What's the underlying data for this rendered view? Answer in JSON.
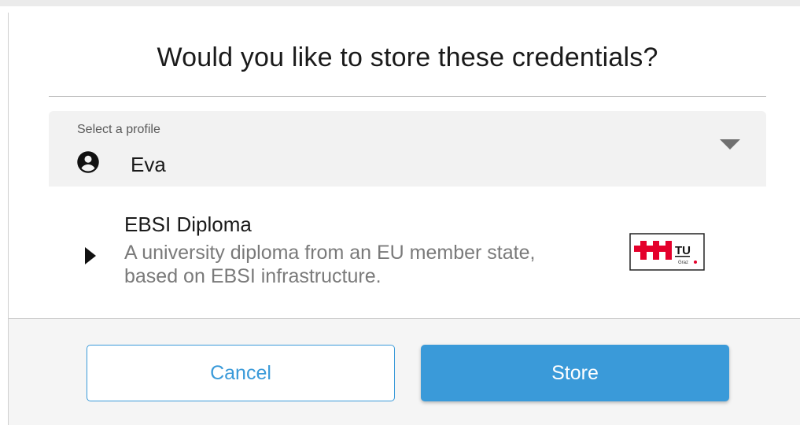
{
  "dialog": {
    "title": "Would you like to store these credentials?"
  },
  "profile_select": {
    "label": "Select a profile",
    "selected_value": "Eva",
    "icon": "account-circle-icon",
    "arrow_icon": "dropdown-arrow-icon"
  },
  "credential": {
    "title": "EBSI Diploma",
    "description": "A university diploma from an EU member state, based on EBSI infrastructure.",
    "toggle_icon": "expand-right-triangle-icon",
    "issuer_logo": {
      "name": "tu-graz-logo",
      "text": "TU",
      "subtext": "Graz"
    }
  },
  "actions": {
    "cancel_label": "Cancel",
    "store_label": "Store"
  },
  "colors": {
    "accent": "#3a9ad9",
    "logo_red": "#e4002b",
    "select_bg": "#f2f2f2",
    "footer_bg": "#f5f5f5"
  }
}
